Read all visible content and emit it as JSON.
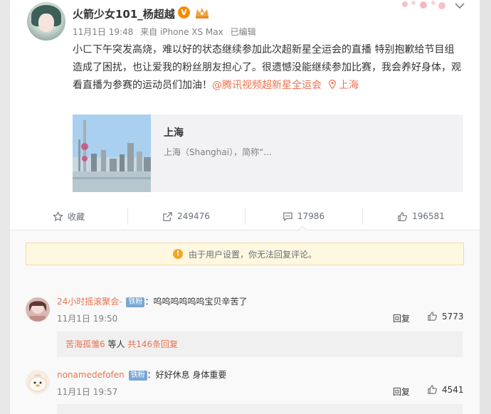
{
  "post": {
    "username": "火箭少女101_杨超越",
    "verified_mark": "V",
    "meta": {
      "date": "11月1日 19:48",
      "source": "来自 iPhone XS Max",
      "edited": "已编辑"
    },
    "content": {
      "text": "小ㄈ下午突发高烧，难以好的状态继续参加此次超新星全运会的直播 特别抱歉给节目组造成了困扰，也让爱我的粉丝朋友担心了。很遗憾没能继续参加比赛，我会养好身体，观看直播为参赛的运动员们加油！",
      "mention": "@腾讯视频超新星全运会",
      "location": "上海"
    },
    "link_card": {
      "title": "上海",
      "desc": "上海（Shanghai），简称“..."
    }
  },
  "actions": {
    "collect": "收藏",
    "repost": "249476",
    "comment": "17986",
    "like": "196581"
  },
  "notice": "由于用户设置，你无法回复评论。",
  "comments": [
    {
      "name": "24小时摇滚聚会-",
      "badge": "铁粉",
      "text": "：呜呜呜呜呜呜宝贝辛苦了",
      "time": "11月1日 19:50",
      "reply": "回复",
      "likes": "5773",
      "sub_name": "苦海孤雏6",
      "sub_mid": " 等人 ",
      "sub_link": "共146条回复"
    },
    {
      "name": "nonamedefofen",
      "badge": "铁粉",
      "text": "：好好休息 身体重要",
      "time": "11月1日 19:57",
      "reply": "回复",
      "likes": "4541"
    }
  ],
  "colors": {
    "accent": "#eb7350",
    "badge": "#7aa8d6",
    "verified": "#f78b00"
  }
}
